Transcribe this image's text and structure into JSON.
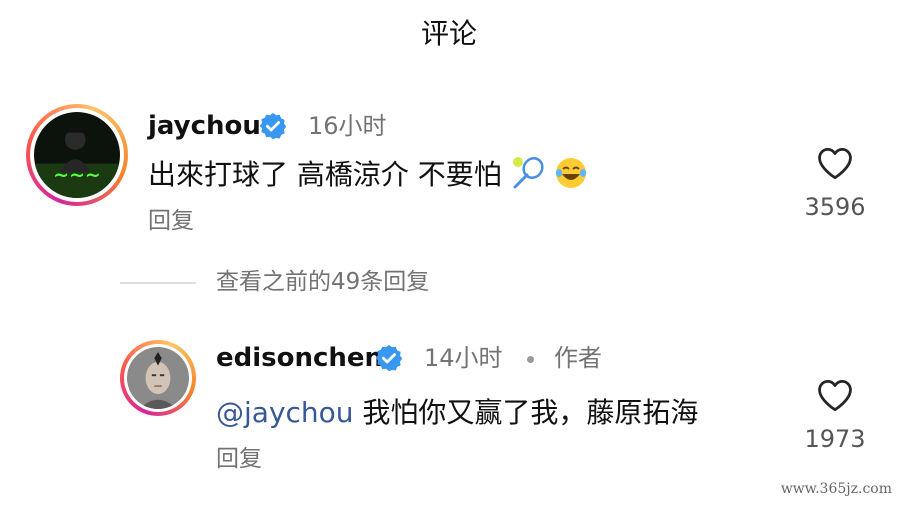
{
  "header": {
    "title": "评论"
  },
  "comments": [
    {
      "username": "jaychou",
      "time": "16小时",
      "text_before": "出來打球了 高橋涼介 不要怕",
      "reply_label": "回复",
      "likes": "3596"
    }
  ],
  "view_replies": "查看之前的49条回复",
  "replies": [
    {
      "username": "edisonchen",
      "time": "14小时",
      "author_badge": "作者",
      "mention": "@jaychou",
      "text": " 我怕你又赢了我，藤原拓海",
      "reply_label": "回复",
      "likes": "1973"
    }
  ],
  "icons": {
    "verified": "verified-badge-icon",
    "like": "heart-outline-icon",
    "emoji_1": "tennis-racket-icon",
    "emoji_2": "laughing-tears-emoji"
  },
  "colors": {
    "verified_blue": "#3897f0",
    "mention": "#385898",
    "secondary": "#737373"
  },
  "watermark": "www.365jz.com"
}
